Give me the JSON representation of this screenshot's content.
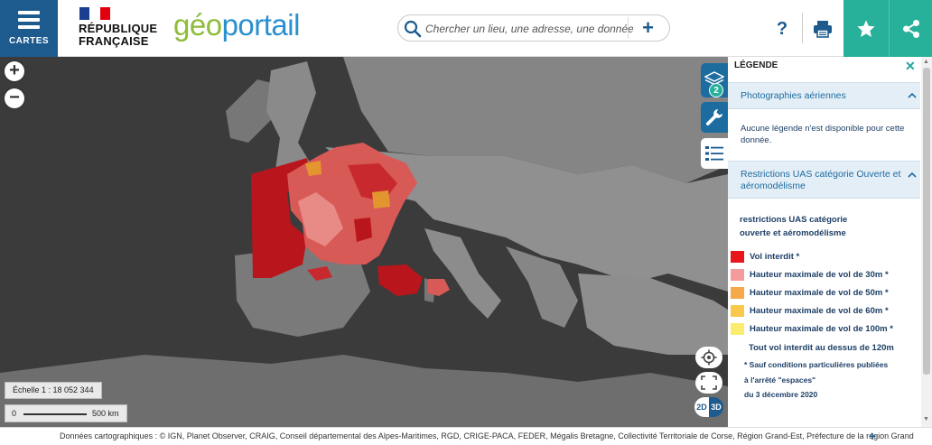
{
  "header": {
    "menu_label": "CARTES",
    "republic_line1": "RÉPUBLIQUE",
    "republic_line2": "FRANÇAISE",
    "logo_geo": "géo",
    "logo_portail": "portail",
    "search_placeholder": "Chercher un lieu, une adresse, une donnée",
    "search_plus": "+",
    "help_label": "?"
  },
  "map": {
    "zoom_in": "+",
    "zoom_out": "−",
    "layers_count": "2",
    "scale_label": "Échelle 1 : 18 052 344",
    "scale_zero": "0",
    "scale_distance": "500 km",
    "btn_2d": "2D",
    "btn_3d": "3D"
  },
  "attribution": {
    "text": "Données cartographiques : ©    IGN,  Planet Observer,  CRAIG,  Conseil départemental des Alpes-Maritimes,  RGD,  CRIGE-PACA,  FEDER,  Mégalis Bretagne,  Collectivité Territoriale de Corse,  Région Grand-Est,  Préfecture de la région Grand",
    "more": "+"
  },
  "legend_panel": {
    "title": "LÉGENDE",
    "close": "✕",
    "sections": [
      {
        "title": "Photographies aériennes",
        "message": "Aucune légende n'est disponible pour cette donnée."
      },
      {
        "title_line1": "Restrictions UAS catégorie Ouverte et",
        "title_line2": "aéromodélisme",
        "legend_title_line1": "restrictions UAS catégorie",
        "legend_title_line2": "ouverte et aéromodélisme",
        "items": [
          {
            "label": "Vol interdit *",
            "color": "#e8161b"
          },
          {
            "label": "Hauteur maximale de vol de 30m *",
            "color": "#f49c9d"
          },
          {
            "label": "Hauteur maximale de vol de 50m *",
            "color": "#f6a84a"
          },
          {
            "label": "Hauteur maximale de vol de 60m *",
            "color": "#f8c94b"
          },
          {
            "label": "Hauteur maximale de vol de 100m *",
            "color": "#fbec6e"
          }
        ],
        "note_main": "Tout vol interdit au dessus de 120m",
        "note_1": "* Sauf conditions particulières publiées",
        "note_2": "à l'arrêté \"espaces\"",
        "note_3": "du 3 décembre 2020"
      }
    ]
  },
  "colors": {
    "brand_blue": "#1d5b8f",
    "accent_teal": "#27b19a",
    "restriction_red": "#c0171c"
  }
}
